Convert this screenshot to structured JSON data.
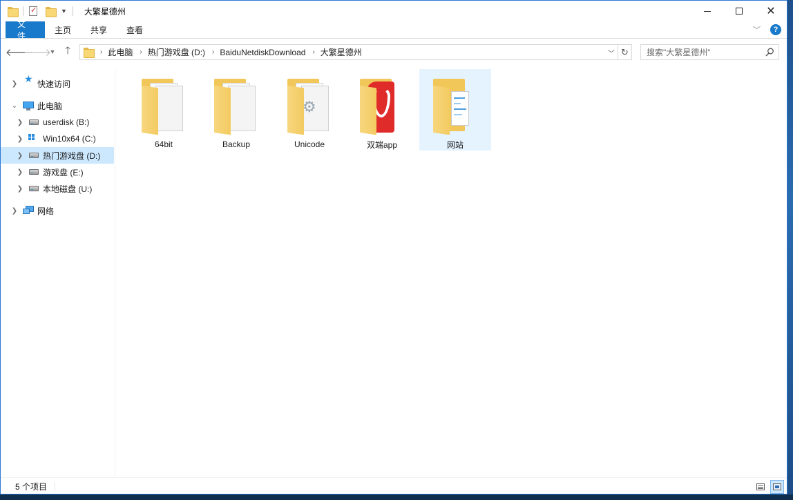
{
  "window": {
    "title": "大繁星德州"
  },
  "ribbon": {
    "tabs": [
      "文件",
      "主页",
      "共享",
      "查看"
    ],
    "help": "?"
  },
  "address": {
    "breadcrumbs": [
      "此电脑",
      "热门游戏盘 (D:)",
      "BaiduNetdiskDownload",
      "大繁星德州"
    ],
    "search_placeholder": "搜索\"大繁星德州\""
  },
  "sidebar": {
    "items": [
      {
        "label": "快速访问",
        "icon": "star-icon"
      },
      {
        "label": "此电脑",
        "icon": "pc-icon",
        "expanded": true
      },
      {
        "label": "userdisk (B:)",
        "icon": "drive-icon"
      },
      {
        "label": "Win10x64 (C:)",
        "icon": "windows-drive-icon"
      },
      {
        "label": "热门游戏盘 (D:)",
        "icon": "drive-icon",
        "selected": true
      },
      {
        "label": "游戏盘 (E:)",
        "icon": "drive-icon"
      },
      {
        "label": "本地磁盘 (U:)",
        "icon": "drive-icon"
      },
      {
        "label": "网络",
        "icon": "network-icon"
      }
    ]
  },
  "files": [
    {
      "name": "64bit",
      "icon": "folder-icon"
    },
    {
      "name": "Backup",
      "icon": "folder-icon"
    },
    {
      "name": "Unicode",
      "icon": "folder-settings-icon"
    },
    {
      "name": "双端app",
      "icon": "folder-app-icon"
    },
    {
      "name": "网站",
      "icon": "folder-web-icon",
      "hovered": true
    }
  ],
  "status": {
    "item_count": "5 个项目"
  },
  "colors": {
    "accent": "#1979ca",
    "selection": "#cce8ff",
    "hover": "#e5f3ff",
    "folder": "#f2c75a"
  }
}
